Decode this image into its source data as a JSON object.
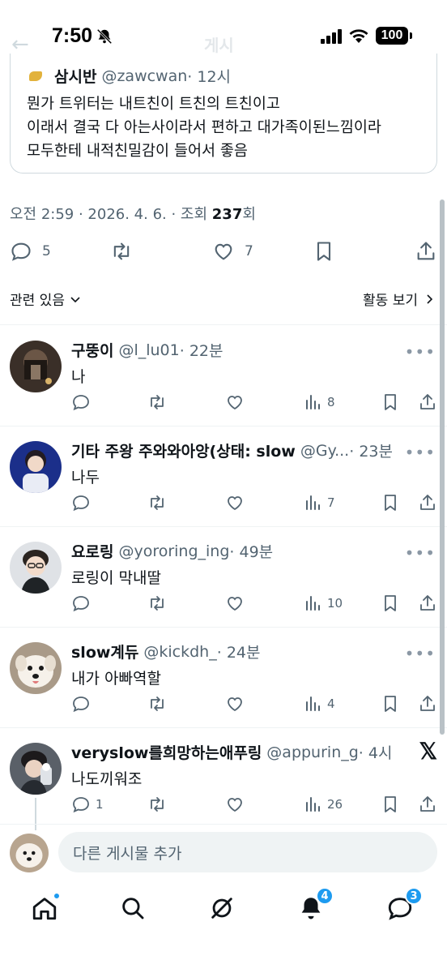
{
  "status": {
    "time": "7:50",
    "battery": "100"
  },
  "header": {
    "faded_title": "게시"
  },
  "quote": {
    "name": "삼시반",
    "handle": "@zawcwan",
    "time": "· 12시",
    "lines": [
      "뭔가 트위터는 내트친이 트친의 트친이고",
      "이래서 결국 다 아는사이라서 편하고 대가족이된느낌이라",
      "모두한테 내적친밀감이 들어서 좋음"
    ]
  },
  "meta": {
    "text": "오전 2:59 · 2026. 4. 6. · 조회 ",
    "views": "237",
    "views_suffix": "회"
  },
  "actions": {
    "replies": "5",
    "likes": "7"
  },
  "related": {
    "label": "관련 있음",
    "activity_label": "활동 보기"
  },
  "replies": [
    {
      "name": "구뚱이",
      "handle": "@l_lu01",
      "time": "· 22분",
      "text": "나",
      "reply_count": "",
      "views": "8"
    },
    {
      "name": "기타 주왕 주와와아앙(상태: slow",
      "handle": "@Gy...",
      "time": "· 23분",
      "text": "나두",
      "reply_count": "",
      "views": "7"
    },
    {
      "name": "요로링",
      "handle": "@yororing_ing",
      "time": "· 49분",
      "text": "로링이 막내딸",
      "reply_count": "",
      "views": "10"
    },
    {
      "name": "slow계듀",
      "handle": "@kickdh_",
      "time": "· 24분",
      "text": "내가 아빠역할",
      "reply_count": "",
      "views": "4"
    },
    {
      "name": "veryslow를희망하는애푸링",
      "handle": "@appurin_g",
      "time": "· 4시",
      "text": "나도끼워조",
      "reply_count": "1",
      "views": "26"
    }
  ],
  "composer": {
    "placeholder": "다른 게시물 추가"
  },
  "tabbar": {
    "notifications_badge": "4",
    "messages_badge": "3"
  },
  "colors": {
    "accent": "#1d9bf0",
    "text": "#0f1419",
    "muted": "#536471",
    "divider": "#eff3f4"
  },
  "icons": [
    "reply-icon",
    "retweet-icon",
    "like-icon",
    "bookmark-icon",
    "share-icon",
    "views-icon",
    "more-icon",
    "home-icon",
    "search-icon",
    "grok-icon",
    "bell-icon",
    "messages-icon",
    "x-logo"
  ]
}
